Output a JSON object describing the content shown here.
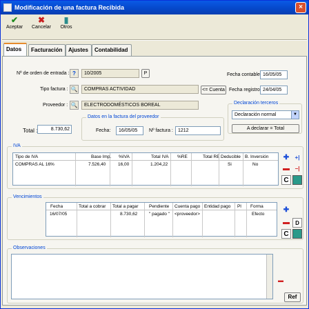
{
  "window": {
    "title": "Modificación de una factura Recibida"
  },
  "toolbar": {
    "accept": "Aceptar",
    "cancel": "Cancelar",
    "others": "Otros"
  },
  "tabs": [
    "Datos",
    "Facturación",
    "Ajustes",
    "Contabilidad"
  ],
  "form": {
    "order_label": "Nº de orden de entrada :",
    "order_help": "?",
    "order_value": "10/2005",
    "order_p_btn": "P",
    "tipo_label": "Tipo factura :",
    "tipo_value": "COMPRAS ACTIVIDAD",
    "cuenta_btn": "<= Cuenta",
    "proveedor_label": "Proveedor :",
    "proveedor_value": "ELECTRODOMÉSTICOS BOREAL",
    "fecha_contable_label": "Fecha contable :",
    "fecha_contable_value": "16/05/05",
    "fecha_registro_label": "Fecha registro :",
    "fecha_registro_value": "24/04/05",
    "declaracion_title": "Declaración terceros",
    "declaracion_value": "Declaración normal",
    "declarar_btn": "A declarar = Total",
    "total_label": "Total :",
    "total_value": "8.730,62",
    "prov_group_title": "Datos en la factura del proveedor",
    "fecha_label": "Fecha:",
    "fecha_value": "16/05/05",
    "nfactura_label": "Nº factura :",
    "nfactura_value": "1212"
  },
  "iva": {
    "title": "IVA",
    "headers": [
      "Tipo de IVA",
      "Base Imp.",
      "%IVA",
      "Total IVA",
      "%RE",
      "Total RE",
      "Deducible",
      "B. Inversión"
    ],
    "rows": [
      [
        "COMPRAS AL 16%",
        "7.526,40",
        "16,00",
        "1.204,22",
        "",
        "",
        "Si",
        "No"
      ]
    ]
  },
  "vencimientos": {
    "title": "Vencimientos",
    "headers": [
      "Fecha",
      "Total a cobrar",
      "Total a pagar",
      "Pendiente",
      "Cuenta pago",
      "Entidad pago",
      "Pl",
      "Forma"
    ],
    "rows": [
      [
        "16/07/05",
        "",
        "8.730,62",
        "\" pagado \"",
        "<proveedor>",
        "",
        "",
        "Efecto"
      ]
    ]
  },
  "observaciones": {
    "title": "Observaciones",
    "ref_btn": "Ref"
  },
  "side_buttons": {
    "c_label": "C",
    "d_label": "D",
    "plus": "+",
    "minus": "−"
  }
}
